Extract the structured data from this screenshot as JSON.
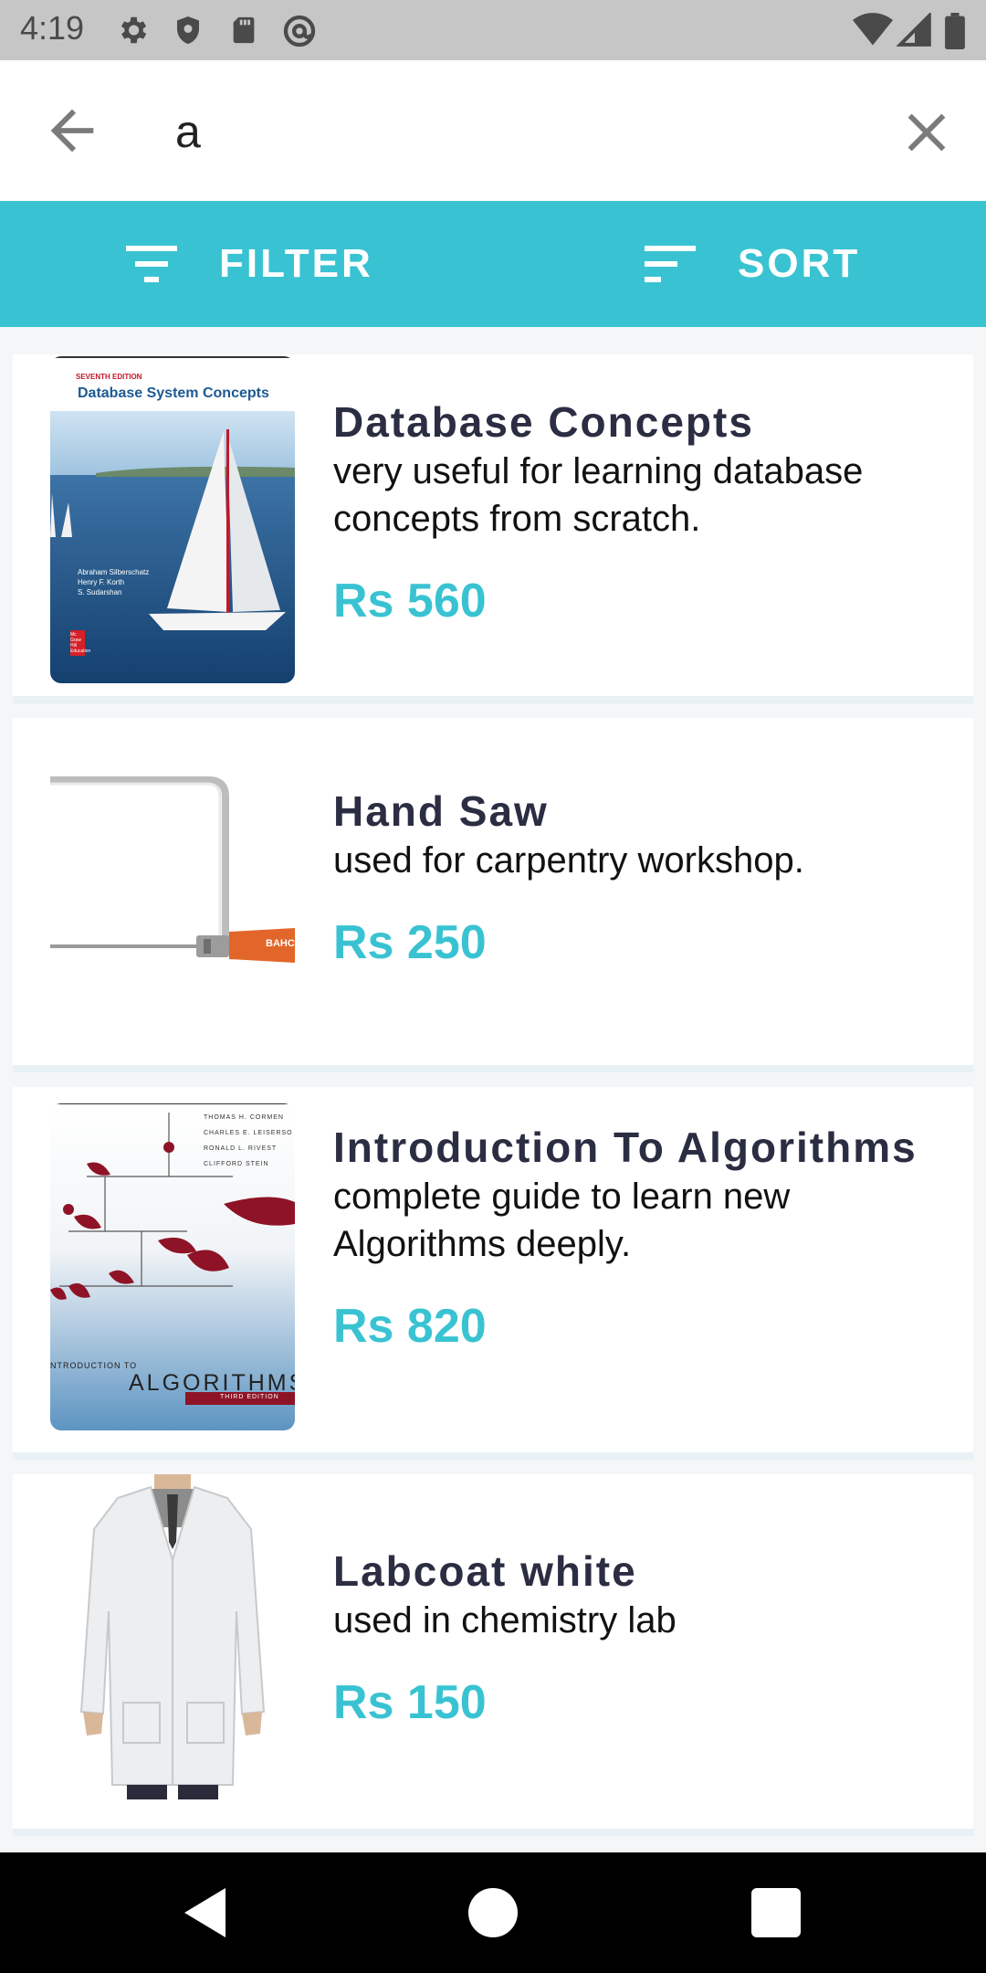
{
  "status_bar": {
    "time": "4:19",
    "icons_left": [
      "settings-icon",
      "shield-icon",
      "sd-card-icon",
      "at-sign-icon"
    ],
    "icons_right": [
      "wifi-icon",
      "signal-icon",
      "battery-icon"
    ]
  },
  "search": {
    "query": "a",
    "back_icon": "arrow-back-icon",
    "clear_icon": "close-icon"
  },
  "toolbar": {
    "filter_label": "FILTER",
    "sort_label": "SORT",
    "accent_color": "#39c3d2"
  },
  "items": [
    {
      "title": "Database Concepts",
      "description": "very useful for learning database concepts from scratch.",
      "price": "Rs 560",
      "image": "book-cover-database-system-concepts",
      "image_text": {
        "edition": "SEVENTH EDITION",
        "title": "Database System Concepts",
        "authors": [
          "Abraham Silberschatz",
          "Henry F. Korth",
          "S. Sudarshan"
        ],
        "publisher": "Mc Graw Hill Education"
      }
    },
    {
      "title": "Hand Saw",
      "description": "used for carpentry workshop.",
      "price": "Rs 250",
      "image": "hacksaw-photo",
      "image_text": {
        "brand": "BAHC"
      }
    },
    {
      "title": "Introduction To Algorithms",
      "description": "complete guide to learn new Algorithms deeply.",
      "price": "Rs 820",
      "image": "book-cover-introduction-to-algorithms",
      "image_text": {
        "authors": [
          "THOMAS H. CORMEN",
          "CHARLES E. LEISERSO",
          "RONALD L. RIVEST",
          "CLIFFORD STEIN"
        ],
        "title": "NTRODUCTION TO",
        "subtitle": "ALGORITHMS",
        "edition": "THIRD EDITION"
      }
    },
    {
      "title": "Labcoat white",
      "description": "used in chemistry lab",
      "price": "Rs 150",
      "image": "labcoat-photo"
    }
  ],
  "nav_bar": {
    "buttons": [
      "back-triangle-icon",
      "home-circle-icon",
      "recents-square-icon"
    ]
  }
}
